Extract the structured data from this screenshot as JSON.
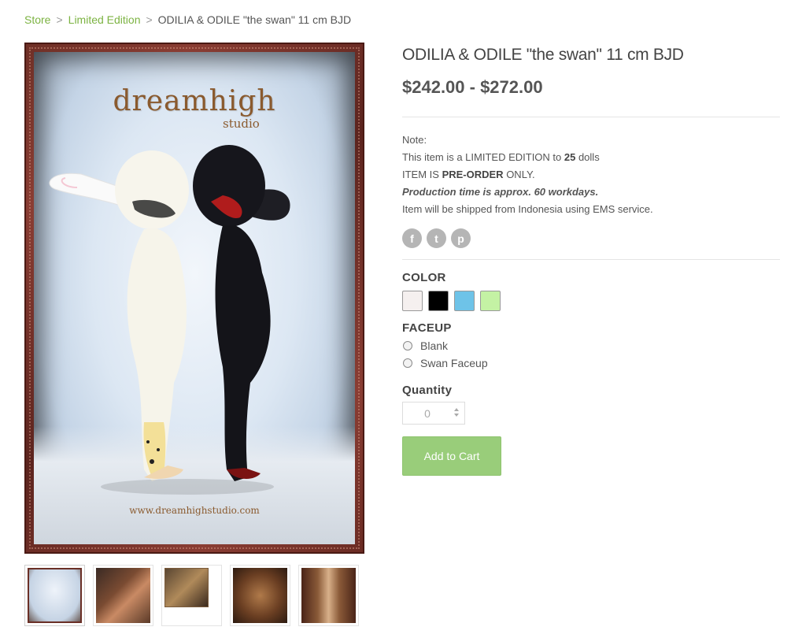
{
  "breadcrumb": {
    "items": [
      "Store",
      "Limited Edition"
    ],
    "separator": ">",
    "current": "ODILIA & ODILE \"the swan\" 11 cm BJD"
  },
  "product": {
    "title": "ODILIA & ODILE \"the swan\" 11 cm BJD",
    "price": "$242.00 - $272.00",
    "image": {
      "brand_top": "dreamhigh",
      "brand_bottom": "studio",
      "website": "www.dreamhighstudio.com"
    },
    "thumbnails_count": 5
  },
  "description": {
    "note": "Note:",
    "line1_prefix": "This item is a LIMITED EDITION to ",
    "line1_bold": "25",
    "line1_suffix": " dolls",
    "line2_prefix": "ITEM IS ",
    "line2_bold": "PRE-ORDER",
    "line2_suffix": " ONLY.",
    "line3": "Production time is approx. 60 workdays.",
    "line4": "Item will be shipped from Indonesia using EMS service."
  },
  "social": {
    "facebook": "f",
    "twitter": "t",
    "pinterest": "p"
  },
  "options": {
    "color_label": "COLOR",
    "colors": [
      "#f5f0ef",
      "#000000",
      "#6ec3e8",
      "#c4f2a4"
    ],
    "faceup_label": "FACEUP",
    "faceup_choices": [
      "Blank",
      "Swan Faceup"
    ]
  },
  "quantity": {
    "label": "Quantity",
    "value": "0"
  },
  "cart": {
    "button_label": "Add to Cart"
  }
}
